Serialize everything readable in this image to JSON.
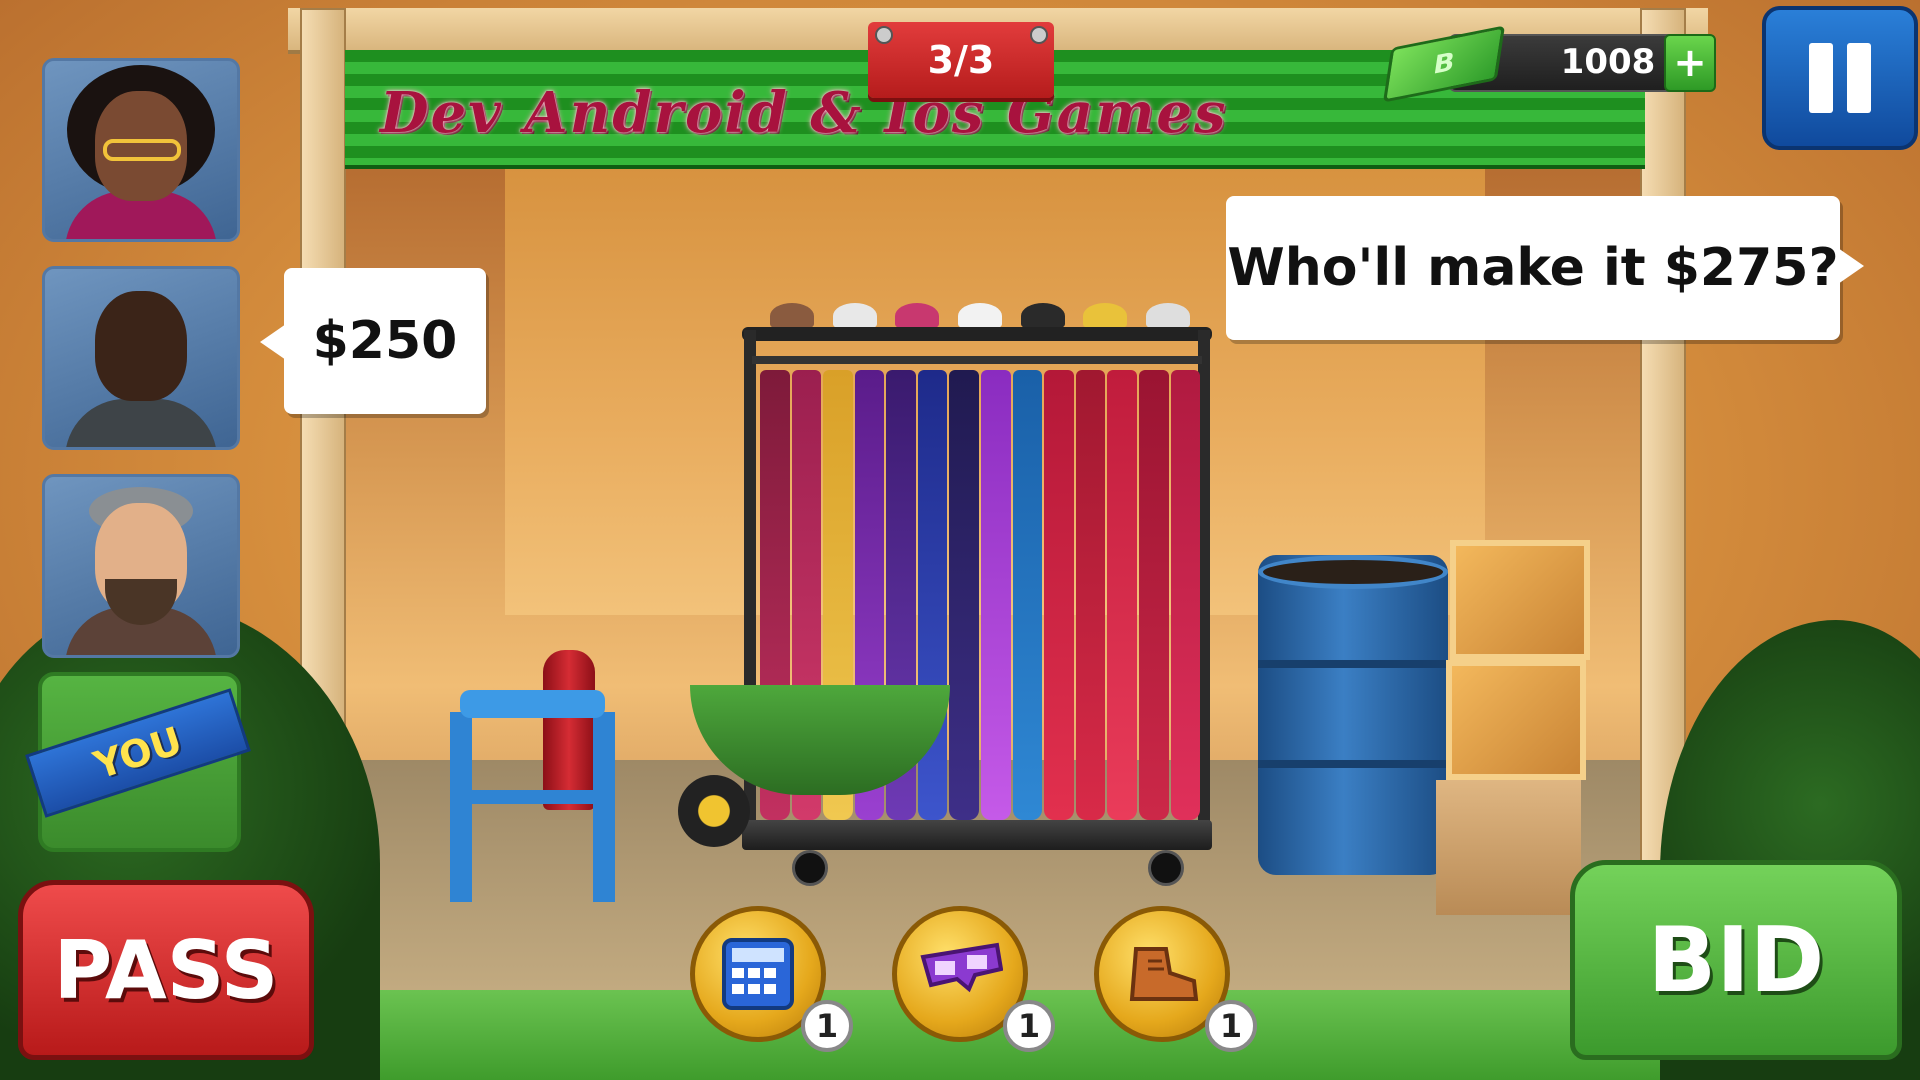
{
  "hud": {
    "round": "3/3",
    "currency_value": "1008",
    "currency_icon_letter": "B",
    "add_label": "+",
    "sponsor_text": "Dev Android & Ios Games"
  },
  "players": [
    {
      "name": "rival-woman",
      "bid": ""
    },
    {
      "name": "rival-man",
      "bid": "$250"
    },
    {
      "name": "rival-bearded",
      "bid": ""
    },
    {
      "name": "you",
      "label": "YOU"
    }
  ],
  "auctioneer": {
    "speech": "Who'll make it $275?"
  },
  "actions": {
    "pass_label": "PASS",
    "bid_label": "BID"
  },
  "tools": [
    {
      "name": "calculator",
      "count": "1"
    },
    {
      "name": "xray-glasses",
      "count": "1"
    },
    {
      "name": "boot",
      "count": "1"
    }
  ],
  "colors": {
    "pass": "#d42a2a",
    "bid": "#5bbb42",
    "banner": "#2aa52d",
    "pause": "#1a5fb8"
  }
}
